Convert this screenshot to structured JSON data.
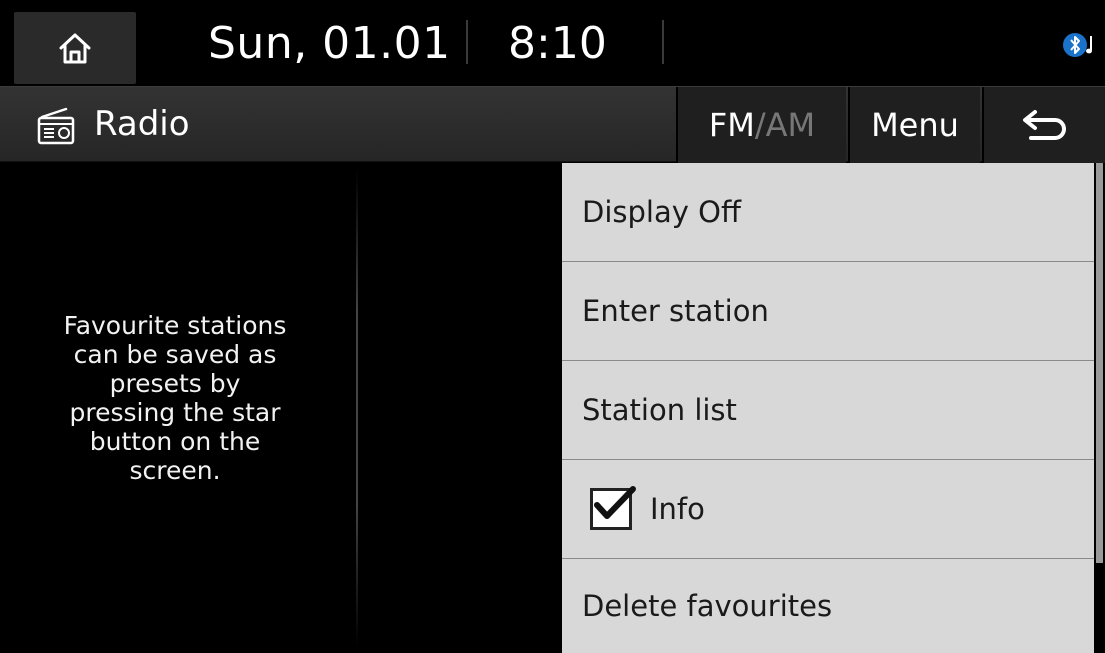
{
  "status_bar": {
    "date": "Sun, 01.01",
    "time": "8:10",
    "icons": {
      "home": "home-icon",
      "bluetooth": "bluetooth-audio-icon"
    }
  },
  "title_bar": {
    "title": "Radio",
    "icon": "radio-icon",
    "band_fm": "FM",
    "band_slash": "/",
    "band_am": "AM",
    "menu_label": "Menu",
    "back_icon": "back-arrow-icon"
  },
  "main": {
    "hint_lines": [
      "Favourite stations",
      "can be saved as",
      "presets by",
      "pressing the star",
      "button on the",
      "screen."
    ]
  },
  "menu": {
    "items": [
      {
        "label": "Display Off"
      },
      {
        "label": "Enter station"
      },
      {
        "label": "Station list"
      },
      {
        "label": "Info",
        "checked": true
      },
      {
        "label": "Delete favourites"
      }
    ]
  },
  "colors": {
    "background": "#000000",
    "menu_background": "#d8d8d8",
    "menu_text": "#1a1a1a",
    "am_inactive": "#777777",
    "title_bar": "#2c2c2c"
  }
}
